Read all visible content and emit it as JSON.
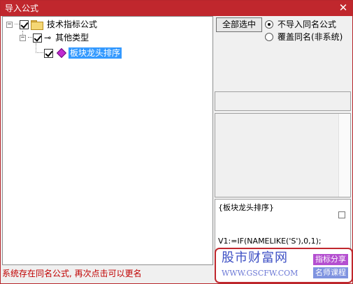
{
  "window": {
    "title": "导入公式",
    "close_glyph": "✕"
  },
  "tree": {
    "root": {
      "label": "技术指标公式",
      "expander": "−",
      "checked": true,
      "icon": "folder-icon"
    },
    "group": {
      "label": "其他类型",
      "expander": "−",
      "checked": true,
      "icon": "key-icon",
      "icon_glyph": "⊸"
    },
    "item": {
      "label": "板块龙头排序",
      "checked": true,
      "selected": true,
      "icon": "diamond-icon"
    }
  },
  "controls": {
    "select_all_label": "全部选中",
    "radio_options": [
      {
        "label": "不导入同名公式",
        "selected": true
      },
      {
        "label": "覆盖同名(非系统)",
        "selected": false
      }
    ]
  },
  "preview": {
    "title": "{板块龙头排序}",
    "code": "V1:=IF(NAMELIKE('S'),0,1);"
  },
  "status_text": "系统存在同名公式, 再次点击可以更名",
  "watermark": {
    "main": "股市财富网",
    "url": "WWW.GSCFW.COM",
    "tag1": "指标分享",
    "tag2": "名师课程"
  },
  "colors": {
    "titlebar": "#c0272d",
    "selection": "#3399ff",
    "status_text": "#c00000"
  }
}
